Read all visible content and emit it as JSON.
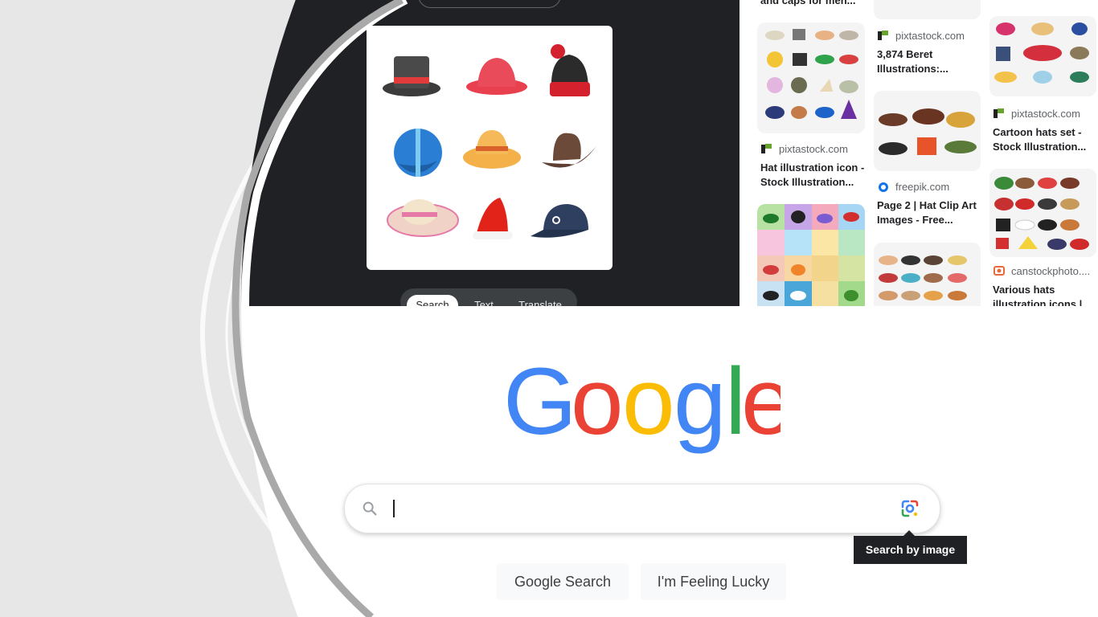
{
  "lens": {
    "tabs": [
      {
        "label": "Search",
        "active": true
      },
      {
        "label": "Text",
        "active": false
      },
      {
        "label": "Translate",
        "active": false
      }
    ]
  },
  "results": {
    "columns": [
      [
        {
          "title": "and caps for men..."
        },
        {
          "site": "pixtastock.com",
          "title": "Hat illustration icon - Stock Illustration..."
        },
        {
          "site": "",
          "title": ""
        }
      ],
      [
        {
          "site": "pixtastock.com",
          "title": "3,874 Beret Illustrations:..."
        },
        {
          "site": "freepik.com",
          "title": "Page 2 | Hat Clip Art Images - Free..."
        }
      ],
      [
        {
          "site": "pixtastock.com",
          "title": "Cartoon hats set - Stock Illustration..."
        },
        {
          "site": "canstockphoto....",
          "title": "Various hats illustration icons |"
        }
      ]
    ]
  },
  "google": {
    "logo_text": "Google",
    "search_placeholder": "",
    "tooltip": "Search by image",
    "buttons": {
      "search": "Google Search",
      "lucky": "I'm Feeling Lucky"
    }
  },
  "colors": {
    "google_blue": "#4285F4",
    "google_red": "#EA4335",
    "google_yellow": "#FBBC05",
    "google_green": "#34A853",
    "lens_dark": "#202124",
    "slide_bg": "#e7e7e8"
  },
  "icons": [
    "search-icon",
    "google-lens-icon",
    "pixta-favicon",
    "freepik-favicon",
    "canstock-favicon"
  ]
}
